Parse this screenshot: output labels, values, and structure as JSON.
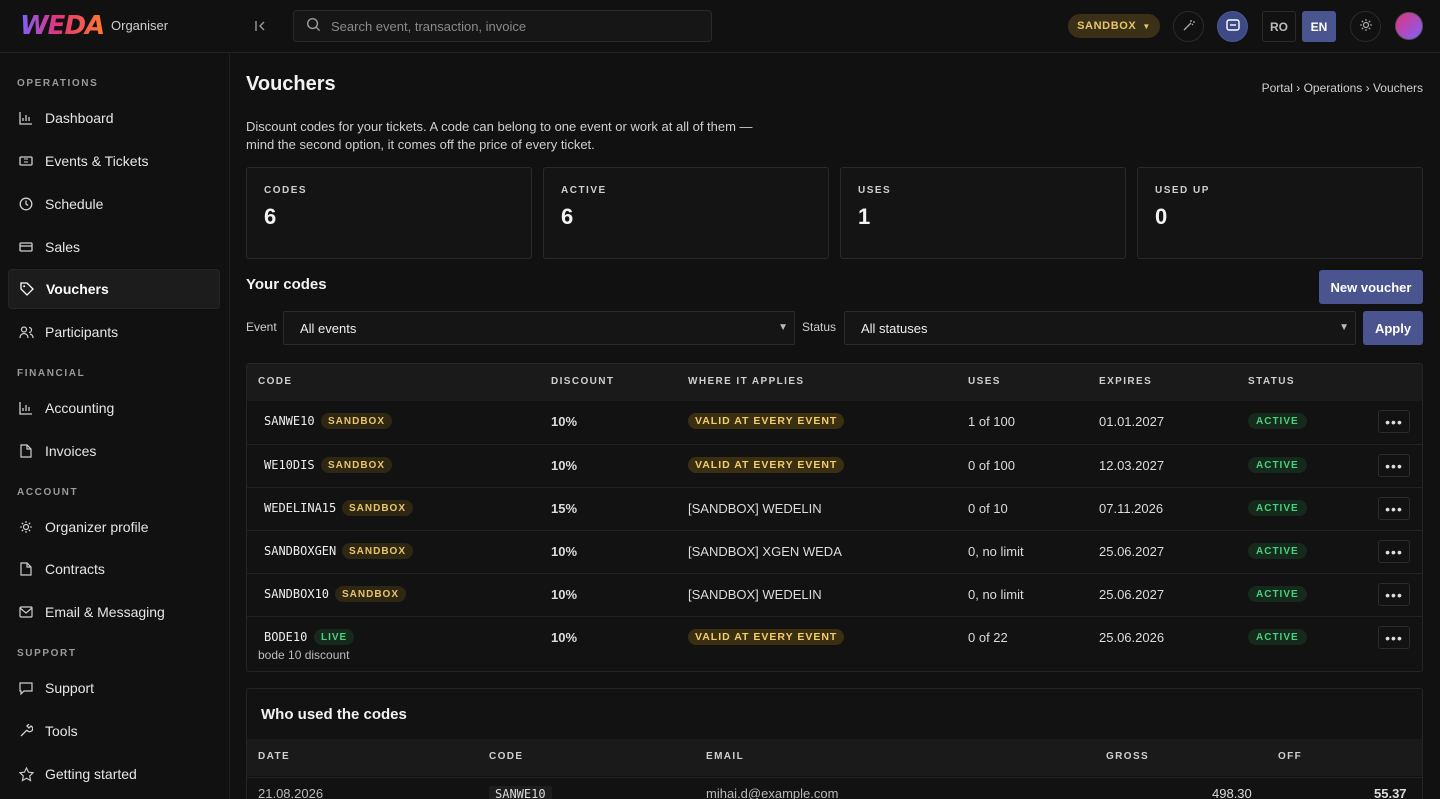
{
  "header": {
    "logo": "WEDA",
    "app_sub": "Organiser",
    "search_placeholder": "Search event, transaction, invoice",
    "env_label": "SANDBOX",
    "lang_ro": "RO",
    "lang_en": "EN"
  },
  "sidebar": {
    "sections": [
      "OPERATIONS",
      "FINANCIAL",
      "ACCOUNT",
      "SUPPORT"
    ],
    "items": [
      {
        "label": "Dashboard",
        "icon": "chart-icon"
      },
      {
        "label": "Events & Tickets",
        "icon": "ticket-icon"
      },
      {
        "label": "Schedule",
        "icon": "clock-icon"
      },
      {
        "label": "Sales",
        "icon": "card-icon"
      },
      {
        "label": "Vouchers",
        "icon": "tag-icon"
      },
      {
        "label": "Participants",
        "icon": "users-icon"
      },
      {
        "label": "Accounting",
        "icon": "chart-icon"
      },
      {
        "label": "Invoices",
        "icon": "file-icon"
      },
      {
        "label": "Organizer profile",
        "icon": "sun-icon"
      },
      {
        "label": "Contracts",
        "icon": "file-icon"
      },
      {
        "label": "Email & Messaging",
        "icon": "mail-icon"
      },
      {
        "label": "Support",
        "icon": "chat-icon"
      },
      {
        "label": "Tools",
        "icon": "wrench-icon"
      },
      {
        "label": "Getting started",
        "icon": "star-icon"
      }
    ]
  },
  "page": {
    "title": "Vouchers",
    "breadcrumb": "Portal › Operations › Vouchers",
    "intro": "Discount codes for your tickets. A code can belong to one event or work at all of them — mind the second option, it comes off the price of every ticket."
  },
  "stats": [
    {
      "label": "CODES",
      "value": "6"
    },
    {
      "label": "ACTIVE",
      "value": "6"
    },
    {
      "label": "USES",
      "value": "1"
    },
    {
      "label": "USED UP",
      "value": "0"
    }
  ],
  "codes_section": {
    "title": "Your codes",
    "new_button": "New voucher",
    "event_label": "Event",
    "event_value": "All events",
    "status_label": "Status",
    "status_value": "All statuses",
    "apply_button": "Apply",
    "columns": [
      "CODE",
      "DISCOUNT",
      "WHERE IT APPLIES",
      "USES",
      "EXPIRES",
      "STATUS"
    ],
    "rows": [
      {
        "code": "SANWE10",
        "env": "SANDBOX",
        "discount": "10%",
        "applies": "VALID AT EVERY EVENT",
        "applies_tag": true,
        "uses": "1 of 100",
        "expires": "01.01.2027",
        "status": "ACTIVE",
        "note": ""
      },
      {
        "code": "WE10DIS",
        "env": "SANDBOX",
        "discount": "10%",
        "applies": "VALID AT EVERY EVENT",
        "applies_tag": true,
        "uses": "0 of 100",
        "expires": "12.03.2027",
        "status": "ACTIVE",
        "note": ""
      },
      {
        "code": "WEDELINA15",
        "env": "SANDBOX",
        "discount": "15%",
        "applies": "[SANDBOX] WEDELIN",
        "applies_tag": false,
        "uses": "0 of 10",
        "expires": "07.11.2026",
        "status": "ACTIVE",
        "note": ""
      },
      {
        "code": "SANDBOXGEN",
        "env": "SANDBOX",
        "discount": "10%",
        "applies": "[SANDBOX] XGEN WEDA",
        "applies_tag": false,
        "uses": "0, no limit",
        "expires": "25.06.2027",
        "status": "ACTIVE",
        "note": ""
      },
      {
        "code": "SANDBOX10",
        "env": "SANDBOX",
        "discount": "10%",
        "applies": "[SANDBOX] WEDELIN",
        "applies_tag": false,
        "uses": "0, no limit",
        "expires": "25.06.2027",
        "status": "ACTIVE",
        "note": ""
      },
      {
        "code": "BODE10",
        "env": "LIVE",
        "discount": "10%",
        "applies": "VALID AT EVERY EVENT",
        "applies_tag": true,
        "uses": "0 of 22",
        "expires": "25.06.2026",
        "status": "ACTIVE",
        "note": "bode 10 discount"
      }
    ]
  },
  "usage_section": {
    "title": "Who used the codes",
    "columns": [
      "DATE",
      "CODE",
      "EMAIL",
      "GROSS",
      "OFF"
    ],
    "rows": [
      {
        "date": "21.08.2026",
        "code": "SANWE10",
        "email": "mihai.d@example.com",
        "gross": "498.30",
        "off": "55.37"
      }
    ]
  },
  "colors": {
    "accent": "#4a5590",
    "sandbox_tag": "#e9c46a",
    "active_tag": "#4ad07a"
  }
}
